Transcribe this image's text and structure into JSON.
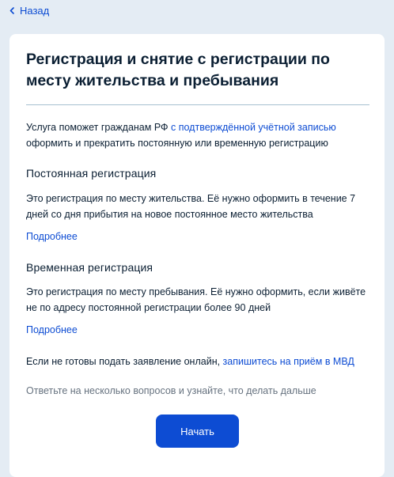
{
  "nav": {
    "back_label": "Назад"
  },
  "card": {
    "title": "Регистрация и снятие с регистрации по месту жительства и пребывания",
    "intro_before": "Услуга поможет гражданам РФ ",
    "intro_link": "с подтверждённой учётной записью",
    "intro_after": " оформить и прекратить постоянную или временную регистрацию",
    "permanent": {
      "heading": "Постоянная регистрация",
      "text": "Это регистрация по месту жительства. Её нужно оформить в течение 7 дней со дня прибытия на новое постоянное место жительства",
      "more": "Подробнее"
    },
    "temporary": {
      "heading": "Временная регистрация",
      "text": "Это регистрация по месту пребывания. Её нужно оформить, если живёте не по адресу постоянной регистрации более 90 дней",
      "more": "Подробнее"
    },
    "offline_before": "Если не готовы подать заявление онлайн, ",
    "offline_link": "запишитесь на приём в МВД",
    "hint": "Ответьте на несколько вопросов и узнайте, что делать дальше",
    "start_label": "Начать"
  },
  "colors": {
    "background": "#e4ecf4",
    "card": "#ffffff",
    "accent": "#0d4cd3",
    "text": "#0b1f33",
    "muted": "#66727f"
  },
  "icons": {
    "back": "chevron-left-icon"
  }
}
